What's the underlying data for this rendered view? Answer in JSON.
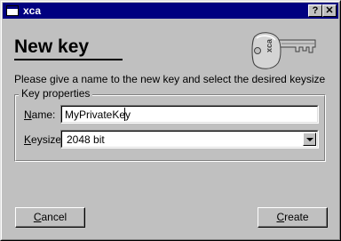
{
  "window": {
    "title": "xca",
    "help_label": "?",
    "close_label": "✕"
  },
  "dialog": {
    "heading": "New key",
    "instructions": "Please give a name to the new key and select the desired keysize",
    "group_label": "Key properties",
    "name_label": "Name:",
    "name_value": "MyPrivateKey",
    "keysize_label": "Keysize",
    "keysize_value": "2048 bit",
    "key_engraving": "xca"
  },
  "buttons": {
    "cancel": "Cancel",
    "create": "Create"
  }
}
